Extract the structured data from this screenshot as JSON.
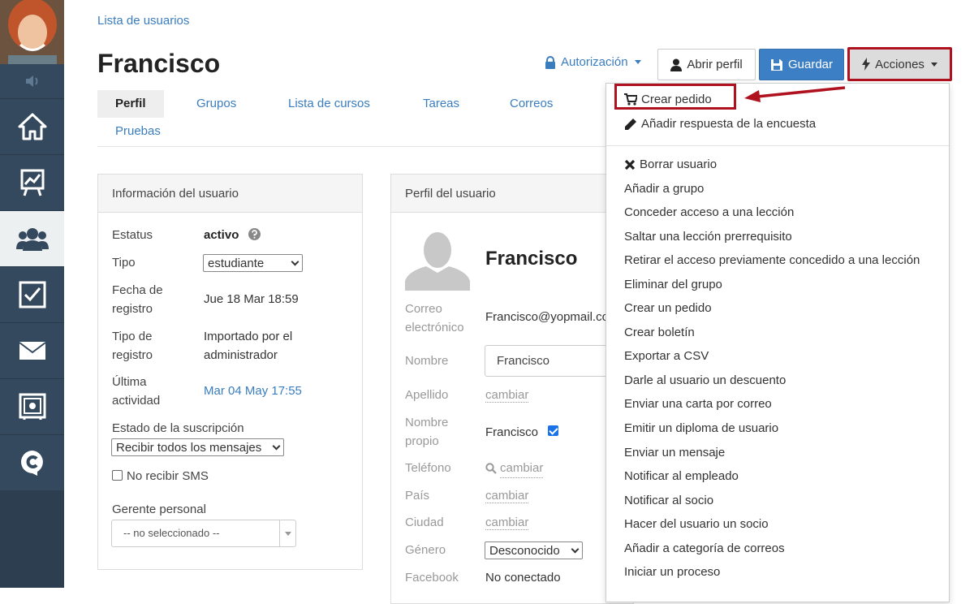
{
  "breadcrumb": "Lista de usuarios",
  "title": "Francisco",
  "header": {
    "authorization": "Autorización",
    "open_profile": "Abrir perfil",
    "save": "Guardar",
    "actions": "Acciones"
  },
  "tabs": [
    "Perfil",
    "Grupos",
    "Lista de cursos",
    "Tareas",
    "Correos",
    "Pruebas"
  ],
  "user_info": {
    "heading": "Información del usuario",
    "status_label": "Estatus",
    "status_value": "activo",
    "type_label": "Tipo",
    "type_value": "estudiante",
    "reg_date_label_1": "Fecha de",
    "reg_date_label_2": "registro",
    "reg_date_value": "Jue 18 Mar 18:59",
    "reg_type_label_1": "Tipo de",
    "reg_type_label_2": "registro",
    "reg_type_value_1": "Importado por el",
    "reg_type_value_2": "administrador",
    "last_activity_label_1": "Última",
    "last_activity_label_2": "actividad",
    "last_activity_value": "Mar 04 May 17:55",
    "subscription_label": "Estado de la suscripción",
    "subscription_value": "Recibir todos los mensajes",
    "no_sms": "No recibir SMS",
    "manager_label": "Gerente personal",
    "manager_value": "-- no seleccionado --"
  },
  "profile": {
    "heading": "Perfil del usuario",
    "name": "Francisco",
    "email_label_1": "Correo",
    "email_label_2": "electrónico",
    "email_value": "Francisco@yopmail.co",
    "first_name_label": "Nombre",
    "first_name_value": "Francisco",
    "last_name_label": "Apellido",
    "change": "cambiar",
    "own_name_label_1": "Nombre",
    "own_name_label_2": "propio",
    "own_name_value": "Francisco",
    "phone_label": "Teléfono",
    "country_label": "País",
    "city_label": "Ciudad",
    "gender_label": "Género",
    "gender_value": "Desconocido",
    "facebook_label": "Facebook",
    "facebook_value": "No conectado"
  },
  "actions_menu": {
    "top": [
      "Crear pedido",
      "Añadir respuesta de la encuesta"
    ],
    "bottom": [
      "Borrar usuario",
      "Añadir a grupo",
      "Conceder acceso a una lección",
      "Saltar una lección prerrequisito",
      "Retirar el acceso previamente concedido a una lección",
      "Eliminar del grupo",
      "Crear un pedido",
      "Crear boletín",
      "Exportar a CSV",
      "Darle al usuario un descuento",
      "Enviar una carta por correo",
      "Emitir un diploma de usuario",
      "Enviar un mensaje",
      "Notificar al empleado",
      "Notificar al socio",
      "Hacer del usuario un socio",
      "Añadir a categoría de correos",
      "Iniciar un proceso"
    ]
  },
  "colors": {
    "link": "#3a7dbf",
    "primary": "#3d7fc4",
    "highlight": "#b0111f",
    "sidebar": "#34495e"
  }
}
